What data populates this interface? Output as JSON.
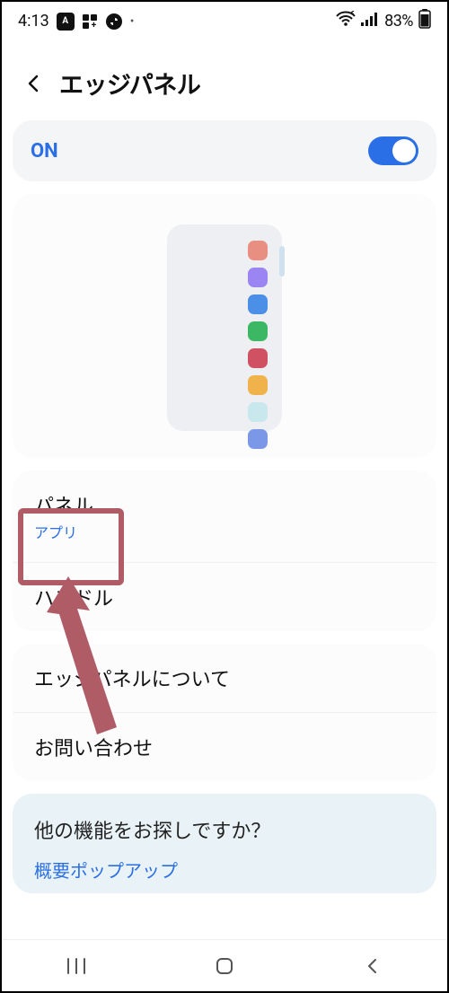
{
  "statusbar": {
    "time": "4:13",
    "battery_text": "83%"
  },
  "header": {
    "title": "エッジパネル"
  },
  "toggle": {
    "label": "ON",
    "on": true
  },
  "list": {
    "items": [
      {
        "title": "パネル",
        "sub": "アプリ"
      },
      {
        "title": "ハンドル"
      }
    ],
    "items2": [
      {
        "title": "エッジパネルについて"
      },
      {
        "title": "お問い合わせ"
      }
    ]
  },
  "suggestion": {
    "title": "他の機能をお探しですか？",
    "link": "概要ポップアップ"
  }
}
